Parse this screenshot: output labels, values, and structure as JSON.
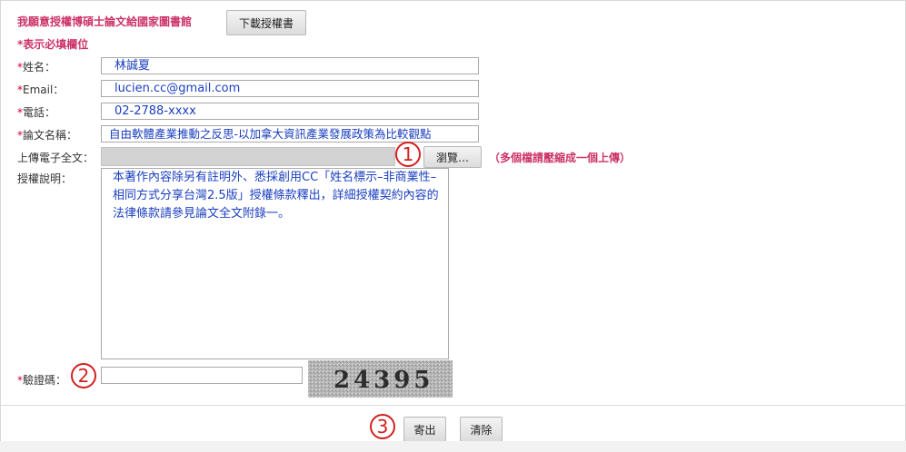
{
  "header": {
    "title": "我願意授權博碩士論文給國家圖書館",
    "download_button": "下載授權書"
  },
  "required_note": "*表示必填欄位",
  "form": {
    "name": {
      "star": "*",
      "label": "姓名：",
      "value": "林誠夏"
    },
    "email": {
      "star": "*",
      "label": "Email：",
      "value": "lucien.cc@gmail.com"
    },
    "phone": {
      "star": "*",
      "label": "電話：",
      "value": "02-2788-xxxx"
    },
    "thesis_title": {
      "star": "*",
      "label": "論文名稱：",
      "value": "自由軟體產業推動之反思-以加拿大資訊產業發展政策為比較觀點"
    },
    "upload": {
      "label": "上傳電子全文：",
      "browse_button": "瀏覽…",
      "note": "（多個檔請壓縮成一個上傳）"
    },
    "license": {
      "label": "授權說明：",
      "text": "本著作內容除另有註明外、悉採創用CC「姓名標示–非商業性–相同方式分享台灣2.5版」授權條款釋出，詳細授權契約內容的法律條款請參見論文全文附錄一。"
    },
    "captcha": {
      "star": "*",
      "label": "驗證碼：",
      "code": "24395"
    }
  },
  "annotations": [
    "1",
    "2",
    "3"
  ],
  "actions": {
    "submit": "寄出",
    "clear": "清除"
  }
}
